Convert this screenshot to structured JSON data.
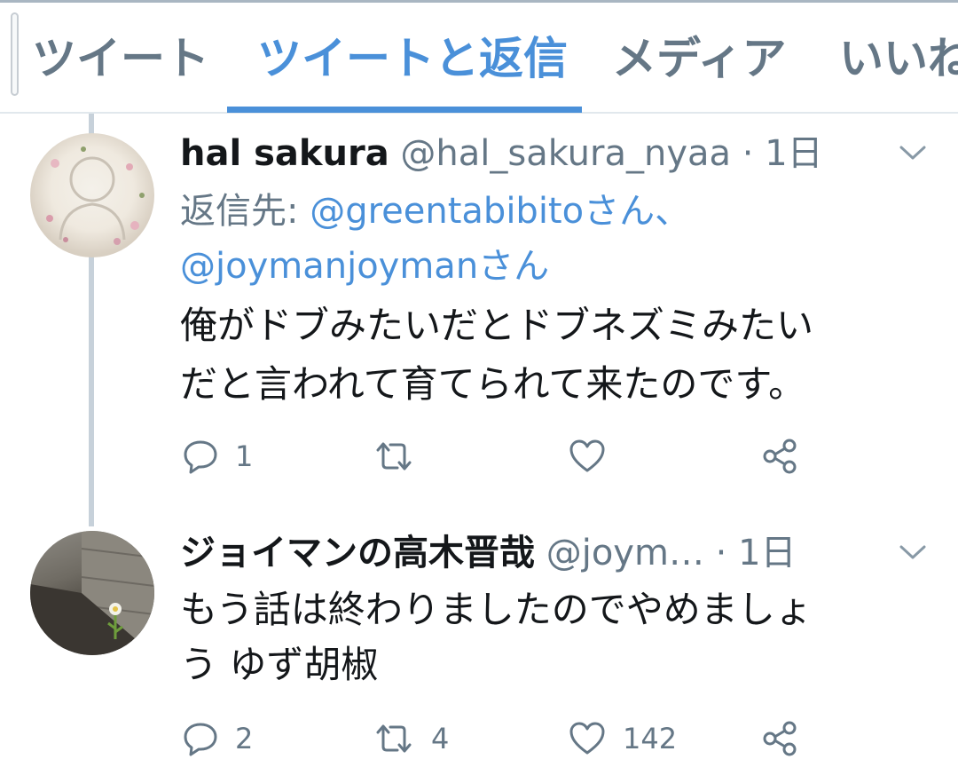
{
  "tabs": [
    {
      "label": "ツイート",
      "active": false
    },
    {
      "label": "ツイートと返信",
      "active": true
    },
    {
      "label": "メディア",
      "active": false
    },
    {
      "label": "いいね",
      "active": false
    }
  ],
  "tweets": [
    {
      "name": "hal sakura",
      "handle": "@hal_sakura_nyaa",
      "separator": "·",
      "time": "1日",
      "reply_label": "返信先:",
      "reply_mention_1": "@greentabibitoさん、",
      "reply_mention_2": "@joymanjoymanさん",
      "text_line_1": "俺がドブみたいだとドブネズミみたい",
      "text_line_2": "だと言われて育てられて来たのです。",
      "reply_count": "1",
      "retweet_count": "",
      "like_count": ""
    },
    {
      "name": "ジョイマンの高木晋哉",
      "handle": "@joym…",
      "separator": "·",
      "time": "1日",
      "text_line_1": "もう話は終わりましたのでやめましょ",
      "text_line_2": "う ゆず胡椒",
      "reply_count": "2",
      "retweet_count": "4",
      "like_count": "142"
    }
  ],
  "colors": {
    "accent": "#4a90d9",
    "secondary_text": "#657786",
    "primary_text": "#14171a"
  }
}
